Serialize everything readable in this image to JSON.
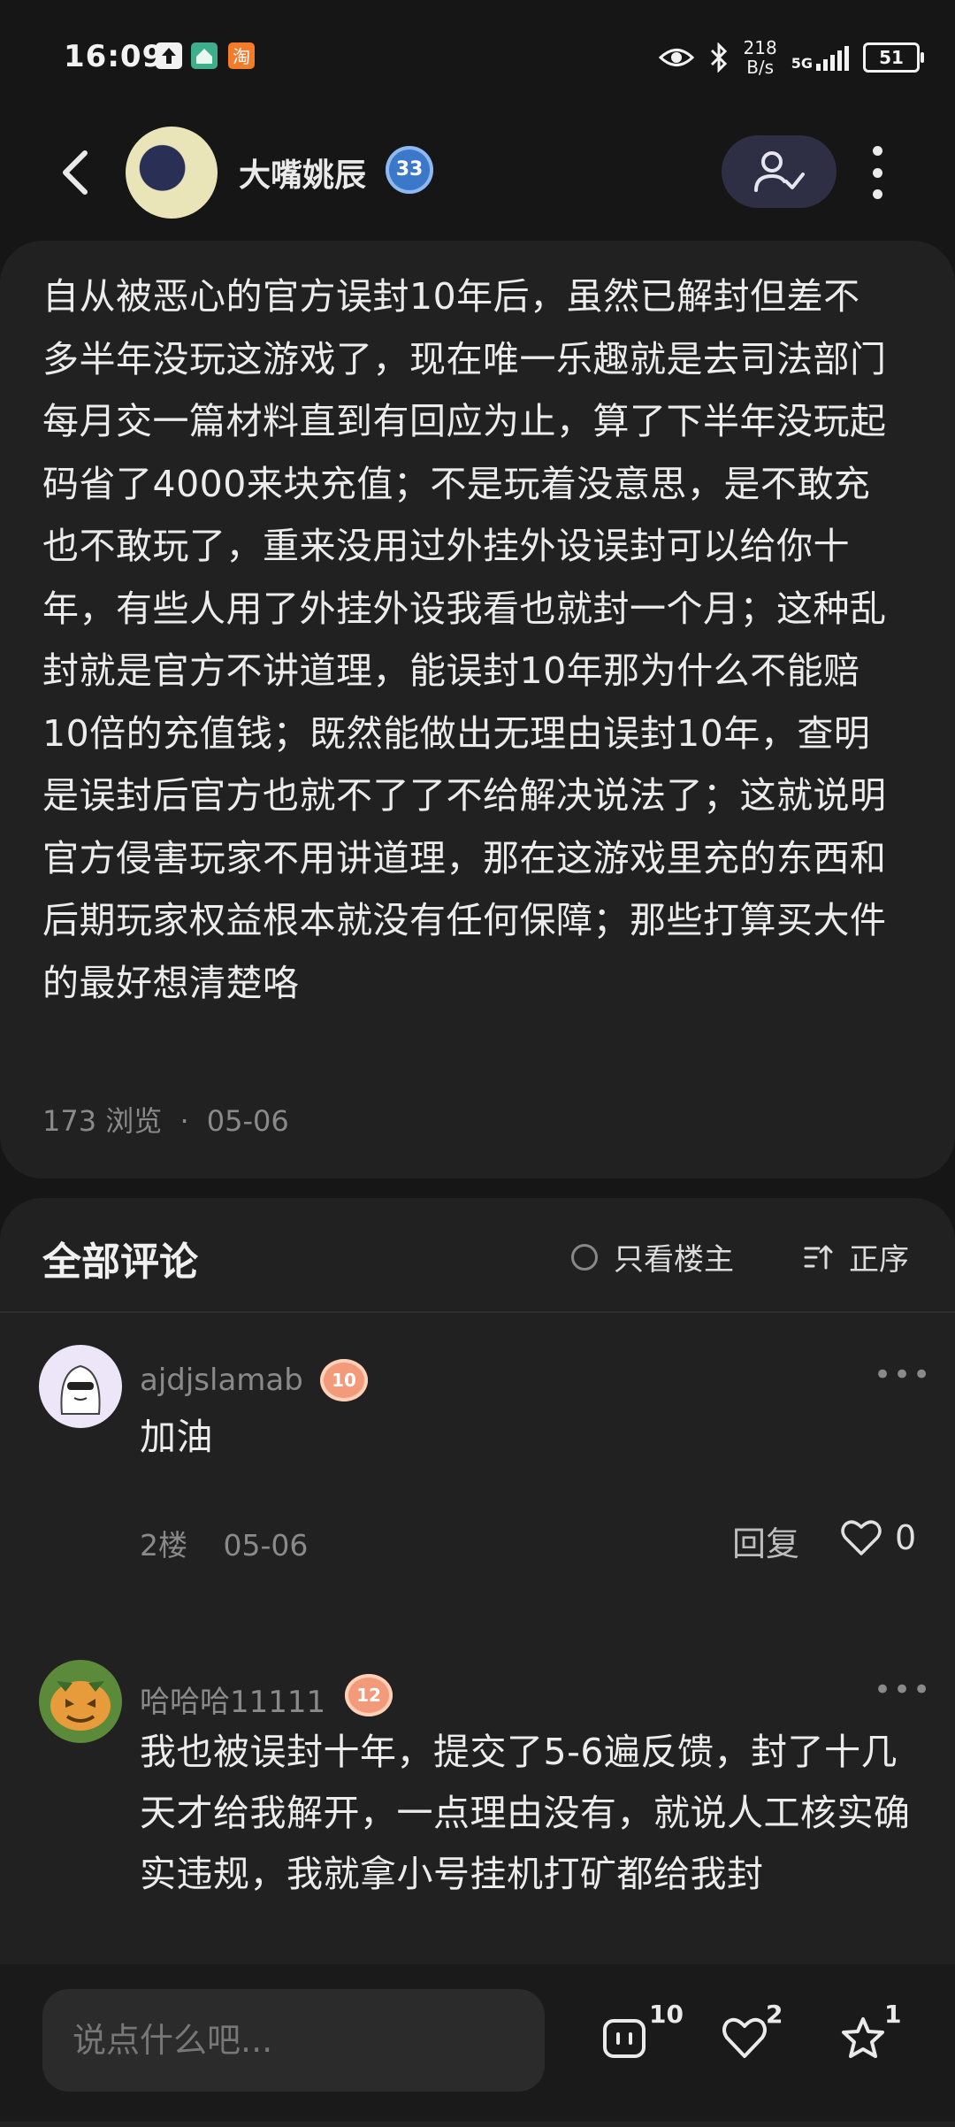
{
  "status_bar": {
    "time": "16:09",
    "speed_value": "218",
    "speed_unit": "B/s",
    "network": "5G",
    "battery": "51"
  },
  "header": {
    "author_name": "大嘴姚辰",
    "level": "33"
  },
  "post": {
    "body": "自从被恶心的官方误封10年后，虽然已解封但差不多半年没玩这游戏了，现在唯一乐趣就是去司法部门每月交一篇材料直到有回应为止，算了下半年没玩起码省了4000来块充值；不是玩着没意思，是不敢充也不敢玩了，重来没用过外挂外设误封可以给你十年，有些人用了外挂外设我看也就封一个月；这种乱封就是官方不讲道理，能误封10年那为什么不能赔10倍的充值钱；既然能做出无理由误封10年，查明是误封后官方也就不了了不给解决说法了；这就说明官方侵害玩家不用讲道理，那在这游戏里充的东西和后期玩家权益根本就没有任何保障；那些打算买大件的最好想清楚咯",
    "views": "173 浏览",
    "dot": "·",
    "date": "05-06"
  },
  "comments_section": {
    "title": "全部评论",
    "only_op_label": "只看楼主",
    "sort_label": "正序"
  },
  "comments": [
    {
      "username": "ajdjslamab",
      "level": "10",
      "text": "加油",
      "floor": "2楼",
      "date": "05-06",
      "reply_label": "回复",
      "likes": "0"
    },
    {
      "username": "哈哈哈11111",
      "level": "12",
      "text": "我也被误封十年，提交了5-6遍反馈，封了十几天才给我解开，一点理由没有，就说人工核实确实违规，我就拿小号挂机打矿都给我封"
    }
  ],
  "bottom_bar": {
    "input_placeholder": "说点什么吧...",
    "comment_count": "10",
    "like_count": "2",
    "favorite_count": "1"
  }
}
